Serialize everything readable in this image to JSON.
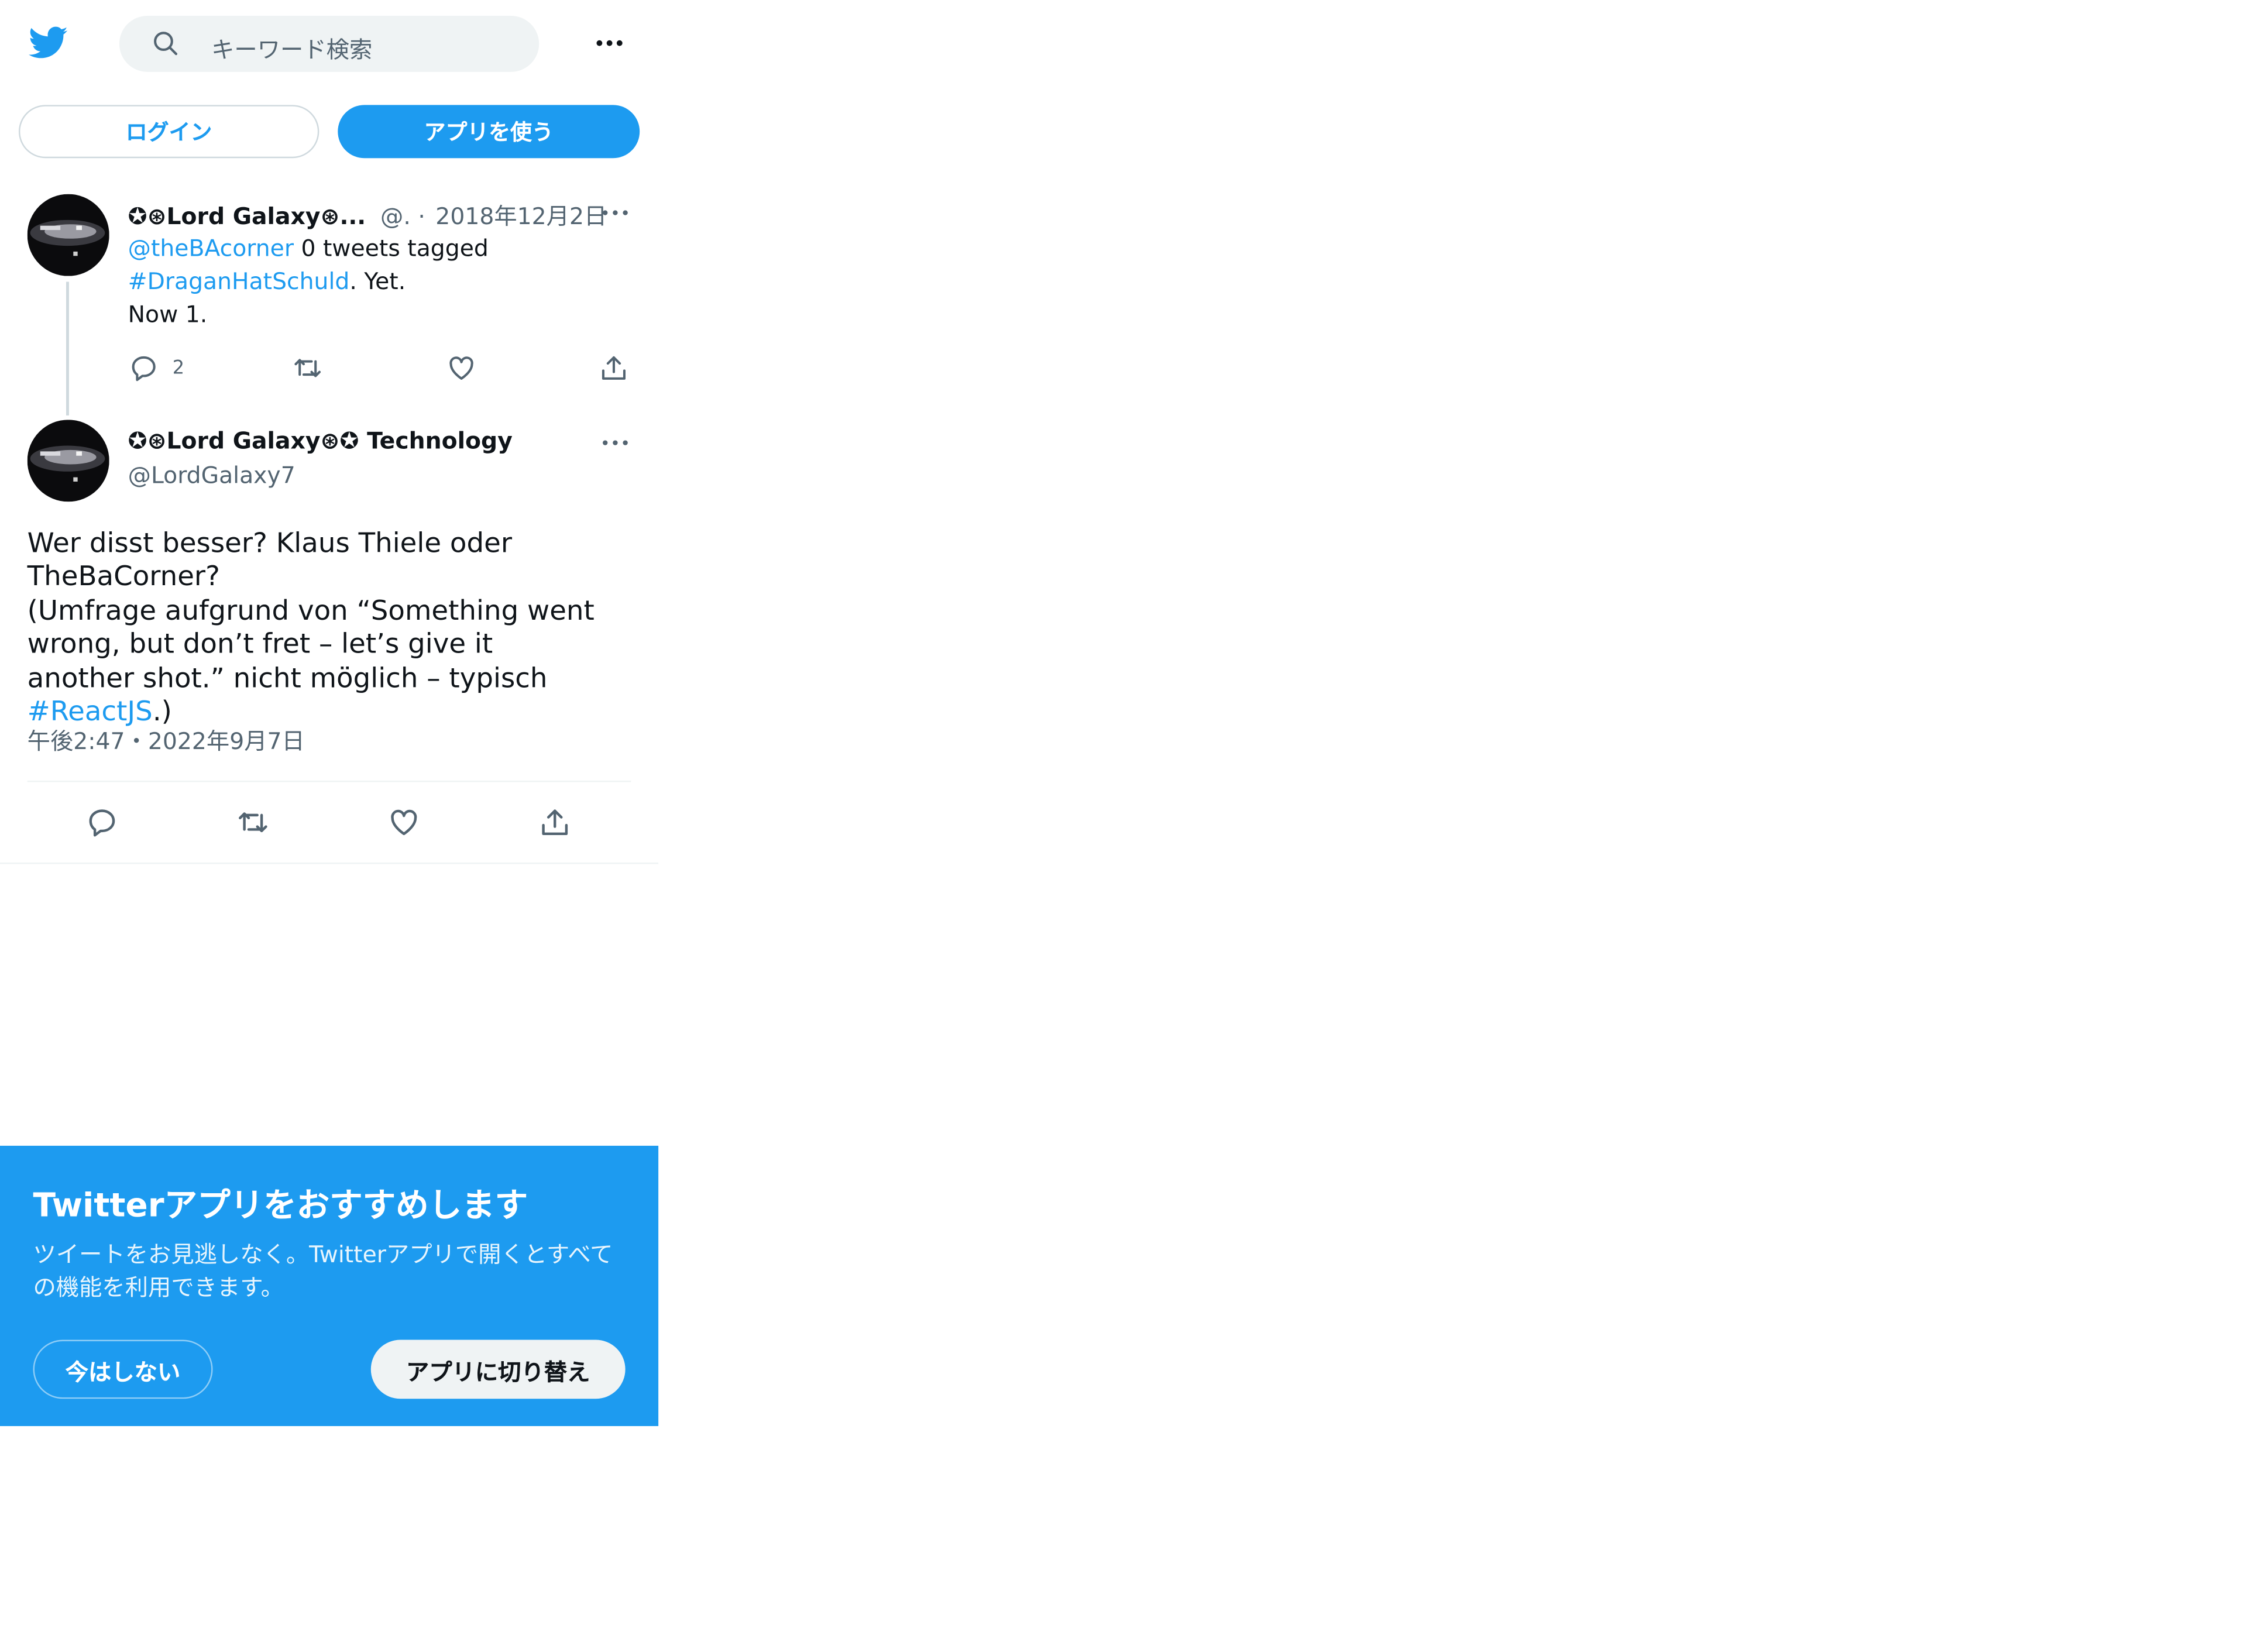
{
  "header": {
    "search_placeholder": "キーワード検索",
    "login_label": "ログイン",
    "use_app_label": "アプリを使う"
  },
  "parent_tweet": {
    "author_name": "✪⊛Lord Galaxy⊛...",
    "handle": "@.",
    "separator": "·",
    "date": "2018年12月2日",
    "mention": "@theBAcorner",
    "text_1": " 0 tweets tagged ",
    "hashtag": "#DraganHatSchuld",
    "text_2": ". Yet.",
    "text_3": "Now 1.",
    "reply_count": "2"
  },
  "main_tweet": {
    "author_name": "✪⊛Lord Galaxy⊛✪ Technology",
    "handle": "@LordGalaxy7",
    "text_main": "Wer disst besser? Klaus Thiele oder TheBaCorner?",
    "text_second": "(Umfrage aufgrund von “Something went wrong, but don’t fret – let’s give it another shot.” nicht möglich – typisch ",
    "hashtag": "#ReactJS",
    "text_end": ".)",
    "timestamp": "午後2:47・2022年9月7日"
  },
  "promo": {
    "title": "Twitterアプリをおすすめします",
    "body": "ツイートをお見逃しなく。Twitterアプリで開くとすべての機能を利用できます。",
    "not_now_label": "今はしない",
    "switch_label": "アプリに切り替え"
  },
  "colors": {
    "brand": "#1d9bf0",
    "text": "#0f1419",
    "muted": "#536471",
    "border": "#cfd9de"
  },
  "icons": [
    "twitter-logo-icon",
    "search-icon",
    "more-icon",
    "reply-icon",
    "retweet-icon",
    "like-icon",
    "share-icon"
  ]
}
